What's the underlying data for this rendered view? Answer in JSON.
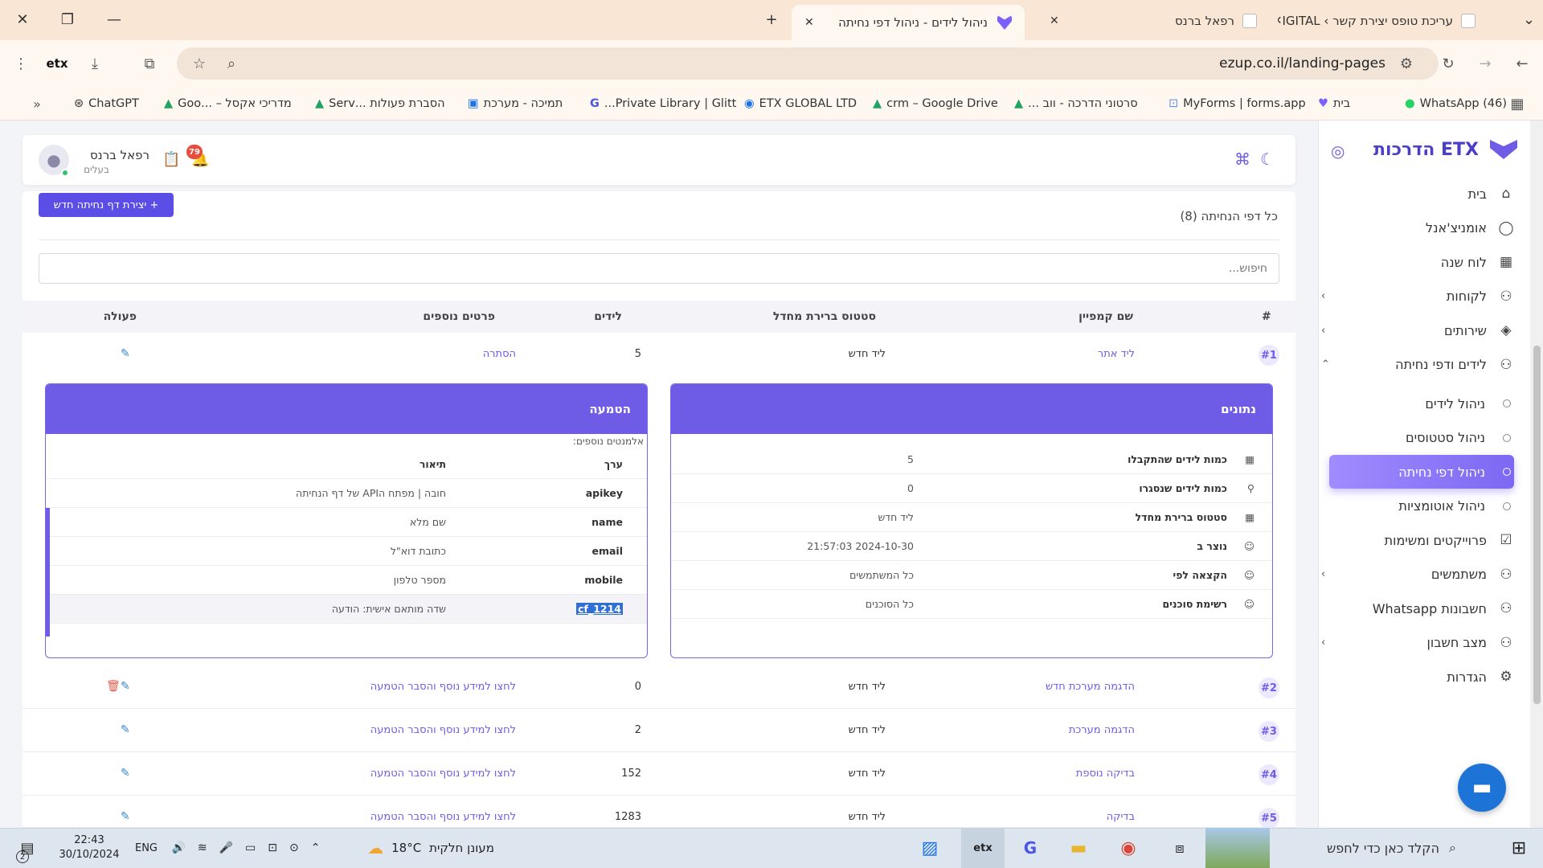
{
  "browser": {
    "tabs": [
      {
        "label": "עריכת טופס יצירת קשר › IGITAL",
        "active": false
      },
      {
        "label": "רפאל ברנס",
        "active": false
      },
      {
        "label": "ניהול לידים - ניהול דפי נחיתה",
        "active": true
      }
    ],
    "url": "ezup.co.il/landing-pages",
    "bookmarks": [
      "(46) WhatsApp",
      "בית",
      "MyForms | forms.app",
      "סרטוני הדרכה - ווב ...",
      "crm – Google Drive",
      "ETX GLOBAL LTD",
      "Private Library | Glitt...",
      "תמיכה - מערכת",
      "הסברת פעולות ...Serv",
      "מדריכי אקסל – ...Goo",
      "ChatGPT"
    ]
  },
  "sidebar": {
    "brand": "ETX הדרכות",
    "items": [
      {
        "label": "בית",
        "icon": "home-icon",
        "chevron": false
      },
      {
        "label": "אומניצ'אנל",
        "icon": "chat-icon",
        "chevron": false
      },
      {
        "label": "לוח שנה",
        "icon": "calendar-icon",
        "chevron": false
      },
      {
        "label": "לקוחות",
        "icon": "users-icon",
        "chevron": true
      },
      {
        "label": "שירותים",
        "icon": "layers-icon",
        "chevron": true
      },
      {
        "label": "לידים ודפי נחיתה",
        "icon": "users-icon",
        "chevron": true,
        "expanded": true
      }
    ],
    "subitems": [
      {
        "label": "ניהול לידים",
        "active": false
      },
      {
        "label": "ניהול סטטוסים",
        "active": false
      },
      {
        "label": "ניהול דפי נחיתה",
        "active": true
      },
      {
        "label": "ניהול אוטומציות",
        "active": false
      }
    ],
    "items2": [
      {
        "label": "פרוייקטים ומשימות",
        "icon": "checkbox-icon",
        "chevron": false
      },
      {
        "label": "משתמשים",
        "icon": "users-icon",
        "chevron": true
      },
      {
        "label": "חשבונות Whatsapp",
        "icon": "users-icon",
        "chevron": false
      },
      {
        "label": "מצב חשבון",
        "icon": "users-icon",
        "chevron": true
      },
      {
        "label": "הגדרות",
        "icon": "gear-icon",
        "chevron": false
      }
    ]
  },
  "header": {
    "user_name": "רפאל ברנס",
    "user_role": "בעלים",
    "notif_count": "79"
  },
  "page": {
    "count_label": "כל דפי הנחיתה (8)",
    "create_button": "+ יצירת דף נחיתה חדש",
    "search_placeholder": "חיפוש...",
    "columns": [
      "#",
      "שם קמפיין",
      "סטטוס ברירת מחדל",
      "לידים",
      "פרטים נוספים",
      "פעולה"
    ],
    "rows": [
      {
        "num": "#1",
        "name": "ליד אתר",
        "status": "ליד חדש",
        "leads": "5",
        "details": "הסתרה",
        "delete": false
      },
      {
        "num": "#2",
        "name": "הדגמה מערכת חדש",
        "status": "ליד חדש",
        "leads": "0",
        "details": "לחצו למידע נוסף והסבר הטמעה",
        "delete": true
      },
      {
        "num": "#3",
        "name": "הדגמה מערכת",
        "status": "ליד חדש",
        "leads": "2",
        "details": "לחצו למידע נוסף והסבר הטמעה",
        "delete": false
      },
      {
        "num": "#4",
        "name": "בדיקה נוספת",
        "status": "ליד חדש",
        "leads": "152",
        "details": "לחצו למידע נוסף והסבר הטמעה",
        "delete": false
      },
      {
        "num": "#5",
        "name": "בדיקה",
        "status": "ליד חדש",
        "leads": "1283",
        "details": "לחצו למידע נוסף והסבר הטמעה",
        "delete": false
      }
    ],
    "data_panel": {
      "title": "נתונים",
      "rows": [
        {
          "label": "כמות לידים שהתקבלו",
          "value": "5",
          "icon": "calendar-icon"
        },
        {
          "label": "כמות לידים שנסגרו",
          "value": "0",
          "icon": "user-icon"
        },
        {
          "label": "סטטוס ברירת מחדל",
          "value": "ליד חדש",
          "icon": "calendar-icon"
        },
        {
          "label": "נוצר ב",
          "value": "2024-10-30 21:57:03",
          "icon": "smile-icon"
        },
        {
          "label": "הקצאה לפי",
          "value": "כל המשתמשים",
          "icon": "smile-icon"
        },
        {
          "label": "רשימת סוכנים",
          "value": "כל הסוכנים",
          "icon": "smile-icon"
        }
      ]
    },
    "embed_panel": {
      "title": "הטמעה",
      "extra_label": "אלמנטים נוספים:",
      "col_value": "ערך",
      "col_desc": "תיאור",
      "rows": [
        {
          "key": "apikey",
          "desc": "חובה | מפתח הAPI של דף הנחיתה"
        },
        {
          "key": "name",
          "desc": "שם מלא"
        },
        {
          "key": "email",
          "desc": "כתובת דוא\"ל"
        },
        {
          "key": "mobile",
          "desc": "מספר טלפון"
        },
        {
          "key": "cf_1214",
          "desc": "שדה מותאם אישית: הודעה"
        }
      ]
    }
  },
  "taskbar": {
    "search_placeholder": "הקלד כאן כדי לחפש",
    "weather": "מעונן חלקית",
    "temp": "18°C",
    "lang": "ENG",
    "time": "22:43",
    "date": "30/10/2024",
    "notif": "2"
  }
}
